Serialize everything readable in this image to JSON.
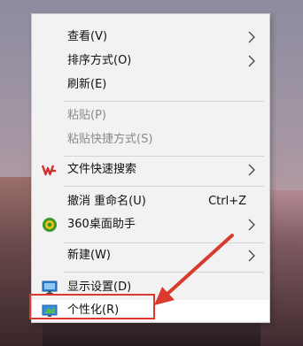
{
  "menu": {
    "items": [
      {
        "label": "查看(V)"
      },
      {
        "label": "排序方式(O)"
      },
      {
        "label": "刷新(E)"
      },
      {
        "label": "粘贴(P)"
      },
      {
        "label": "粘贴快捷方式(S)"
      },
      {
        "label": "文件快速搜索"
      },
      {
        "label": "撤消 重命名(U)",
        "shortcut": "Ctrl+Z"
      },
      {
        "label": "360桌面助手"
      },
      {
        "label": "新建(W)"
      },
      {
        "label": "显示设置(D)"
      },
      {
        "label": "个性化(R)"
      }
    ]
  },
  "colors": {
    "menu_bg": "#f2f2f2",
    "disabled_text": "#8a8a8a",
    "callout_red": "#d93b2e",
    "wps_red": "#d0312d"
  },
  "icons": [
    "chevron-right-icon",
    "wps-logo-icon",
    "360-assistant-icon",
    "monitor-icon",
    "personalize-icon"
  ]
}
